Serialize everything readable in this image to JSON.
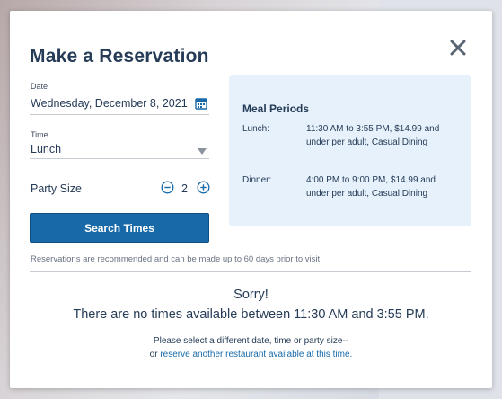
{
  "modal": {
    "title": "Make a Reservation",
    "close_icon": "close-icon"
  },
  "form": {
    "date_label": "Date",
    "date_value": "Wednesday, December 8, 2021",
    "time_label": "Time",
    "time_value": "Lunch",
    "party_label": "Party Size",
    "party_value": "2",
    "search_label": "Search Times"
  },
  "meal_periods": {
    "title": "Meal Periods",
    "items": [
      {
        "label": "Lunch:",
        "detail": "11:30 AM to 3:55 PM, $14.99 and under per adult, Casual Dining"
      },
      {
        "label": "Dinner:",
        "detail": "4:00 PM to 9:00 PM, $14.99 and under per adult, Casual Dining"
      }
    ]
  },
  "note": "Reservations are recommended and can be made up to 60 days prior to visit.",
  "result": {
    "sorry": "Sorry!",
    "message": "There are no times available between 11:30 AM and 3:55 PM.",
    "hint": "Please select a different date, time or party size--",
    "hint_prefix": "or ",
    "hint_link": "reserve another restaurant available at this time."
  },
  "colors": {
    "primary": "#1769a8",
    "heading": "#253b56",
    "meal_box_bg": "#e6f1fc"
  }
}
